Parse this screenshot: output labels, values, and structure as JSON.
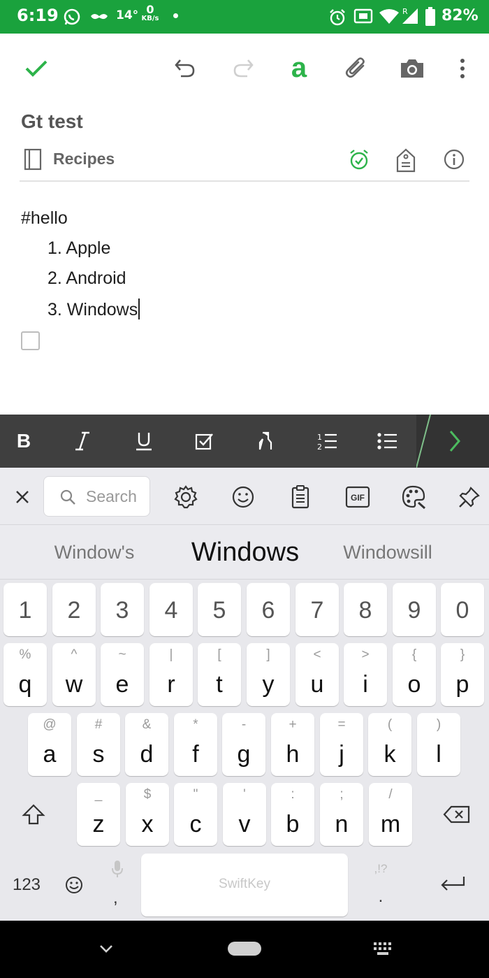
{
  "status_bar": {
    "time": "6:19",
    "temperature": "14°",
    "net_speed_value": "0",
    "net_speed_unit": "KB/s",
    "battery": "82%",
    "background_color": "#1aa23d"
  },
  "toolbar": {
    "done_icon": "check-icon",
    "undo_icon": "undo-icon",
    "redo_icon": "redo-icon",
    "format_letter": "a",
    "attach_icon": "paperclip-icon",
    "camera_icon": "camera-icon",
    "more_icon": "more-vert-icon",
    "accent_color": "#2db34a"
  },
  "note": {
    "title": "Gt test",
    "notebook": "Recipes",
    "tag_line": "#hello",
    "list": [
      "1. Apple",
      "2. Android",
      "3. Windows"
    ]
  },
  "format_bar": {
    "bold_label": "B",
    "background_color": "#3f3f3f"
  },
  "keyboard": {
    "search_placeholder": "Search",
    "gif_label": "GIF",
    "suggestions": [
      "Window's",
      "Windows",
      "Windowsill"
    ],
    "number_row": [
      "1",
      "2",
      "3",
      "4",
      "5",
      "6",
      "7",
      "8",
      "9",
      "0"
    ],
    "row1": [
      {
        "main": "q",
        "sub": "%"
      },
      {
        "main": "w",
        "sub": "^"
      },
      {
        "main": "e",
        "sub": "~"
      },
      {
        "main": "r",
        "sub": "|"
      },
      {
        "main": "t",
        "sub": "["
      },
      {
        "main": "y",
        "sub": "]"
      },
      {
        "main": "u",
        "sub": "<"
      },
      {
        "main": "i",
        "sub": ">"
      },
      {
        "main": "o",
        "sub": "{"
      },
      {
        "main": "p",
        "sub": "}"
      }
    ],
    "row2": [
      {
        "main": "a",
        "sub": "@"
      },
      {
        "main": "s",
        "sub": "#"
      },
      {
        "main": "d",
        "sub": "&"
      },
      {
        "main": "f",
        "sub": "*"
      },
      {
        "main": "g",
        "sub": "-"
      },
      {
        "main": "h",
        "sub": "+"
      },
      {
        "main": "j",
        "sub": "="
      },
      {
        "main": "k",
        "sub": "("
      },
      {
        "main": "l",
        "sub": ")"
      }
    ],
    "row3": [
      {
        "main": "z",
        "sub": "_"
      },
      {
        "main": "x",
        "sub": "$"
      },
      {
        "main": "c",
        "sub": "\""
      },
      {
        "main": "v",
        "sub": "'"
      },
      {
        "main": "b",
        "sub": ":"
      },
      {
        "main": "n",
        "sub": ";"
      },
      {
        "main": "m",
        "sub": "/"
      }
    ],
    "numbers_key": "123",
    "comma_key": ",",
    "period_key": ".",
    "period_sub": ",!?",
    "space_brand": "SwiftKey"
  }
}
